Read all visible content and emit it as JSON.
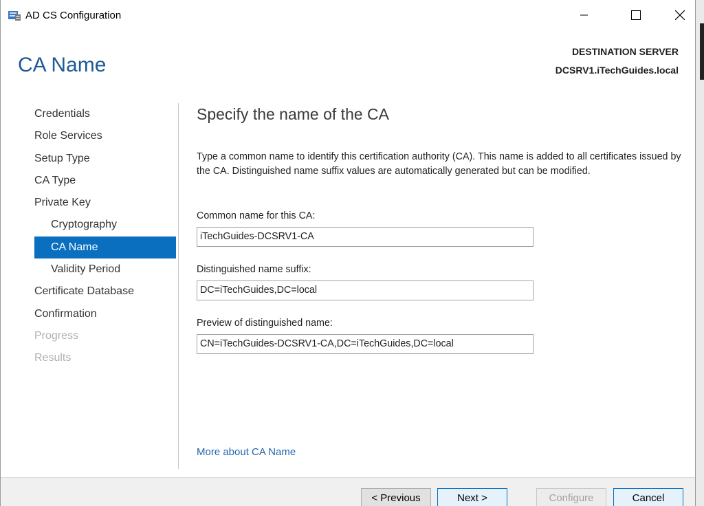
{
  "window": {
    "title": "AD CS Configuration"
  },
  "header": {
    "page_title": "CA Name",
    "destination_label": "DESTINATION SERVER",
    "destination_server": "DCSRV1.iTechGuides.local"
  },
  "nav": {
    "items": [
      {
        "label": "Credentials"
      },
      {
        "label": "Role Services"
      },
      {
        "label": "Setup Type"
      },
      {
        "label": "CA Type"
      },
      {
        "label": "Private Key"
      },
      {
        "label": "Cryptography"
      },
      {
        "label": "CA Name"
      },
      {
        "label": "Validity Period"
      },
      {
        "label": "Certificate Database"
      },
      {
        "label": "Confirmation"
      },
      {
        "label": "Progress"
      },
      {
        "label": "Results"
      }
    ]
  },
  "main": {
    "heading": "Specify the name of the CA",
    "description": "Type a common name to identify this certification authority (CA). This name is added to all certificates issued by the CA. Distinguished name suffix values are automatically generated but can be modified.",
    "common_name_label": "Common name for this CA:",
    "common_name_value": "iTechGuides-DCSRV1-CA",
    "suffix_label": "Distinguished name suffix:",
    "suffix_value": "DC=iTechGuides,DC=local",
    "preview_label": "Preview of distinguished name:",
    "preview_value": "CN=iTechGuides-DCSRV1-CA,DC=iTechGuides,DC=local",
    "more_link": "More about CA Name"
  },
  "footer": {
    "previous": "< Previous",
    "next": "Next >",
    "configure": "Configure",
    "cancel": "Cancel"
  },
  "colors": {
    "accent": "#0a6fbf",
    "title": "#1e5a96",
    "link": "#2266b0"
  }
}
